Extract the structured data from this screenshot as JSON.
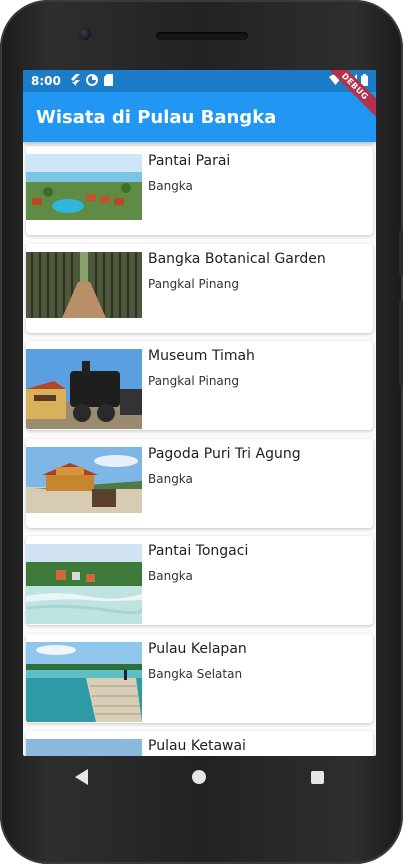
{
  "status_bar": {
    "time": "8:00",
    "ribbon": "DEBUG"
  },
  "app_bar": {
    "title": "Wisata di Pulau Bangka"
  },
  "places": [
    {
      "name": "Pantai Parai",
      "location": "Bangka"
    },
    {
      "name": "Bangka Botanical Garden",
      "location": "Pangkal Pinang"
    },
    {
      "name": "Museum Timah",
      "location": "Pangkal Pinang"
    },
    {
      "name": "Pagoda Puri Tri Agung",
      "location": "Bangka"
    },
    {
      "name": "Pantai Tongaci",
      "location": "Bangka"
    },
    {
      "name": "Pulau Kelapan",
      "location": "Bangka Selatan"
    },
    {
      "name": "Pulau Ketawai",
      "location": ""
    }
  ],
  "colors": {
    "status_bar": "#1c7cc8",
    "app_bar": "#2196f3",
    "ribbon": "#b3324c"
  },
  "icons": [
    "flutter-icon",
    "data-saver-icon",
    "sd-card-icon",
    "wifi-icon",
    "signal-icon",
    "battery-icon",
    "back-icon",
    "home-icon",
    "recents-icon"
  ]
}
